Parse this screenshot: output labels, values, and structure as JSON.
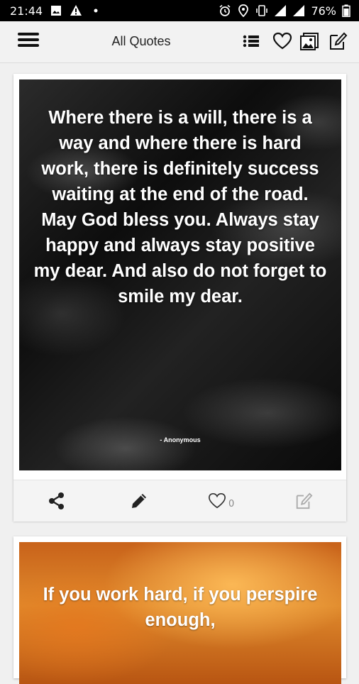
{
  "status_bar": {
    "time": "21:44",
    "battery": "76%",
    "left_icons": [
      "image-icon",
      "warning-icon",
      "dot-icon"
    ],
    "right_icons": [
      "alarm-icon",
      "location-icon",
      "vibrate-icon",
      "signal-icon",
      "signal-icon",
      "battery-icon"
    ]
  },
  "app_bar": {
    "title": "All Quotes",
    "icons": [
      "menu-icon",
      "list-icon",
      "heart-icon",
      "gallery-icon",
      "edit-icon"
    ]
  },
  "cards": [
    {
      "quote": "Where there is a will, there is a way and where there is hard work, there is definitely success waiting at the end of the road. May God bless you. Always stay happy and always stay positive my dear. And also do not forget to smile my dear.",
      "author": "- Anonymous",
      "likes": "0",
      "actions": [
        "share-icon",
        "pencil-icon",
        "heart-icon",
        "edit-icon"
      ]
    },
    {
      "quote": "If you work hard, if you perspire enough,"
    }
  ]
}
